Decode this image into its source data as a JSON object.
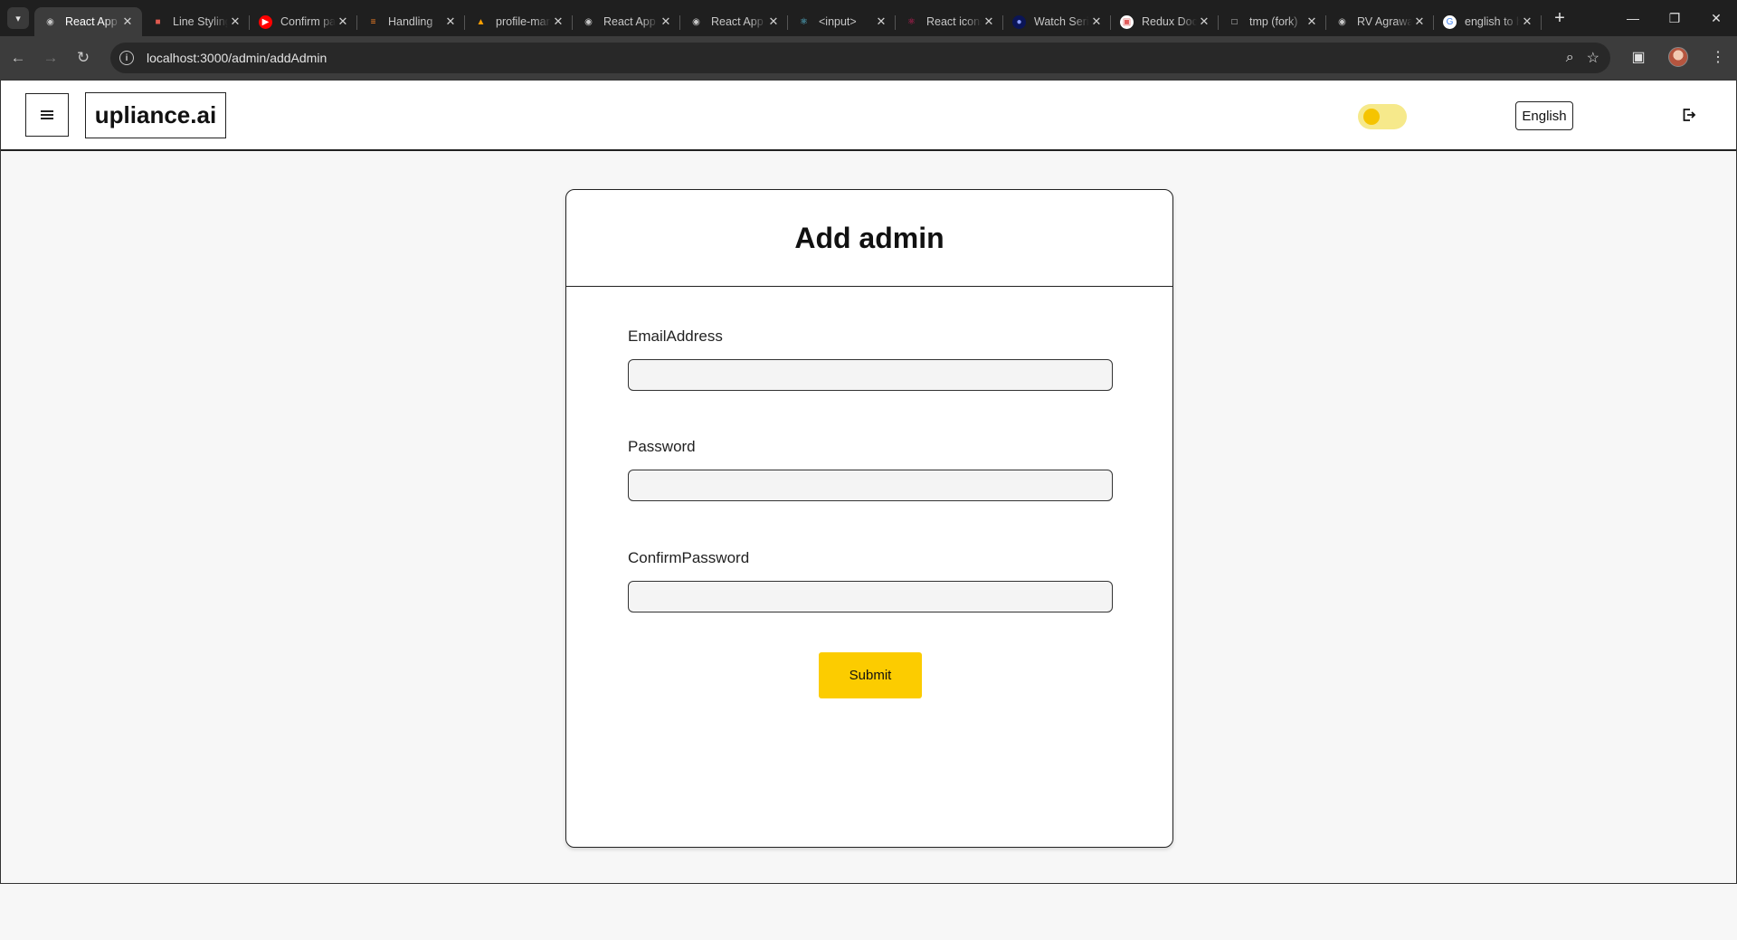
{
  "browser": {
    "tabs": [
      {
        "title": "React App",
        "favicon": "globe-icon",
        "active": true
      },
      {
        "title": "Line Styling",
        "favicon": "cube-icon",
        "active": false
      },
      {
        "title": "Confirm password",
        "favicon": "youtube-icon",
        "active": false
      },
      {
        "title": "Handling",
        "favicon": "stackoverflow-icon",
        "active": false
      },
      {
        "title": "profile-management",
        "favicon": "firebase-icon",
        "active": false
      },
      {
        "title": "React App",
        "favicon": "globe-icon",
        "active": false
      },
      {
        "title": "React App",
        "favicon": "globe-icon",
        "active": false
      },
      {
        "title": "<input>",
        "favicon": "react-icon",
        "active": false
      },
      {
        "title": "React icons",
        "favicon": "react-icons-icon",
        "active": false
      },
      {
        "title": "Watch Series",
        "favicon": "watch-icon",
        "active": false
      },
      {
        "title": "Redux Docs",
        "favicon": "redux-icon",
        "active": false
      },
      {
        "title": "tmp (fork)",
        "favicon": "square-icon",
        "active": false
      },
      {
        "title": "RV Agrawal",
        "favicon": "globe-icon",
        "active": false
      },
      {
        "title": "english to hindi",
        "favicon": "google-icon",
        "active": false
      }
    ],
    "url": "localhost:3000/admin/addAdmin"
  },
  "header": {
    "logo": "upliance.ai",
    "language": "English",
    "theme_toggle_on": true
  },
  "form": {
    "title": "Add admin",
    "email_label": "EmailAddress",
    "email_value": "",
    "password_label": "Password",
    "password_value": "",
    "confirm_label": "ConfirmPassword",
    "confirm_value": "",
    "submit_label": "Submit"
  },
  "colors": {
    "accent": "#fccc00",
    "toggle_track": "#f6e98b",
    "chrome_dark": "#1f1f1f"
  }
}
